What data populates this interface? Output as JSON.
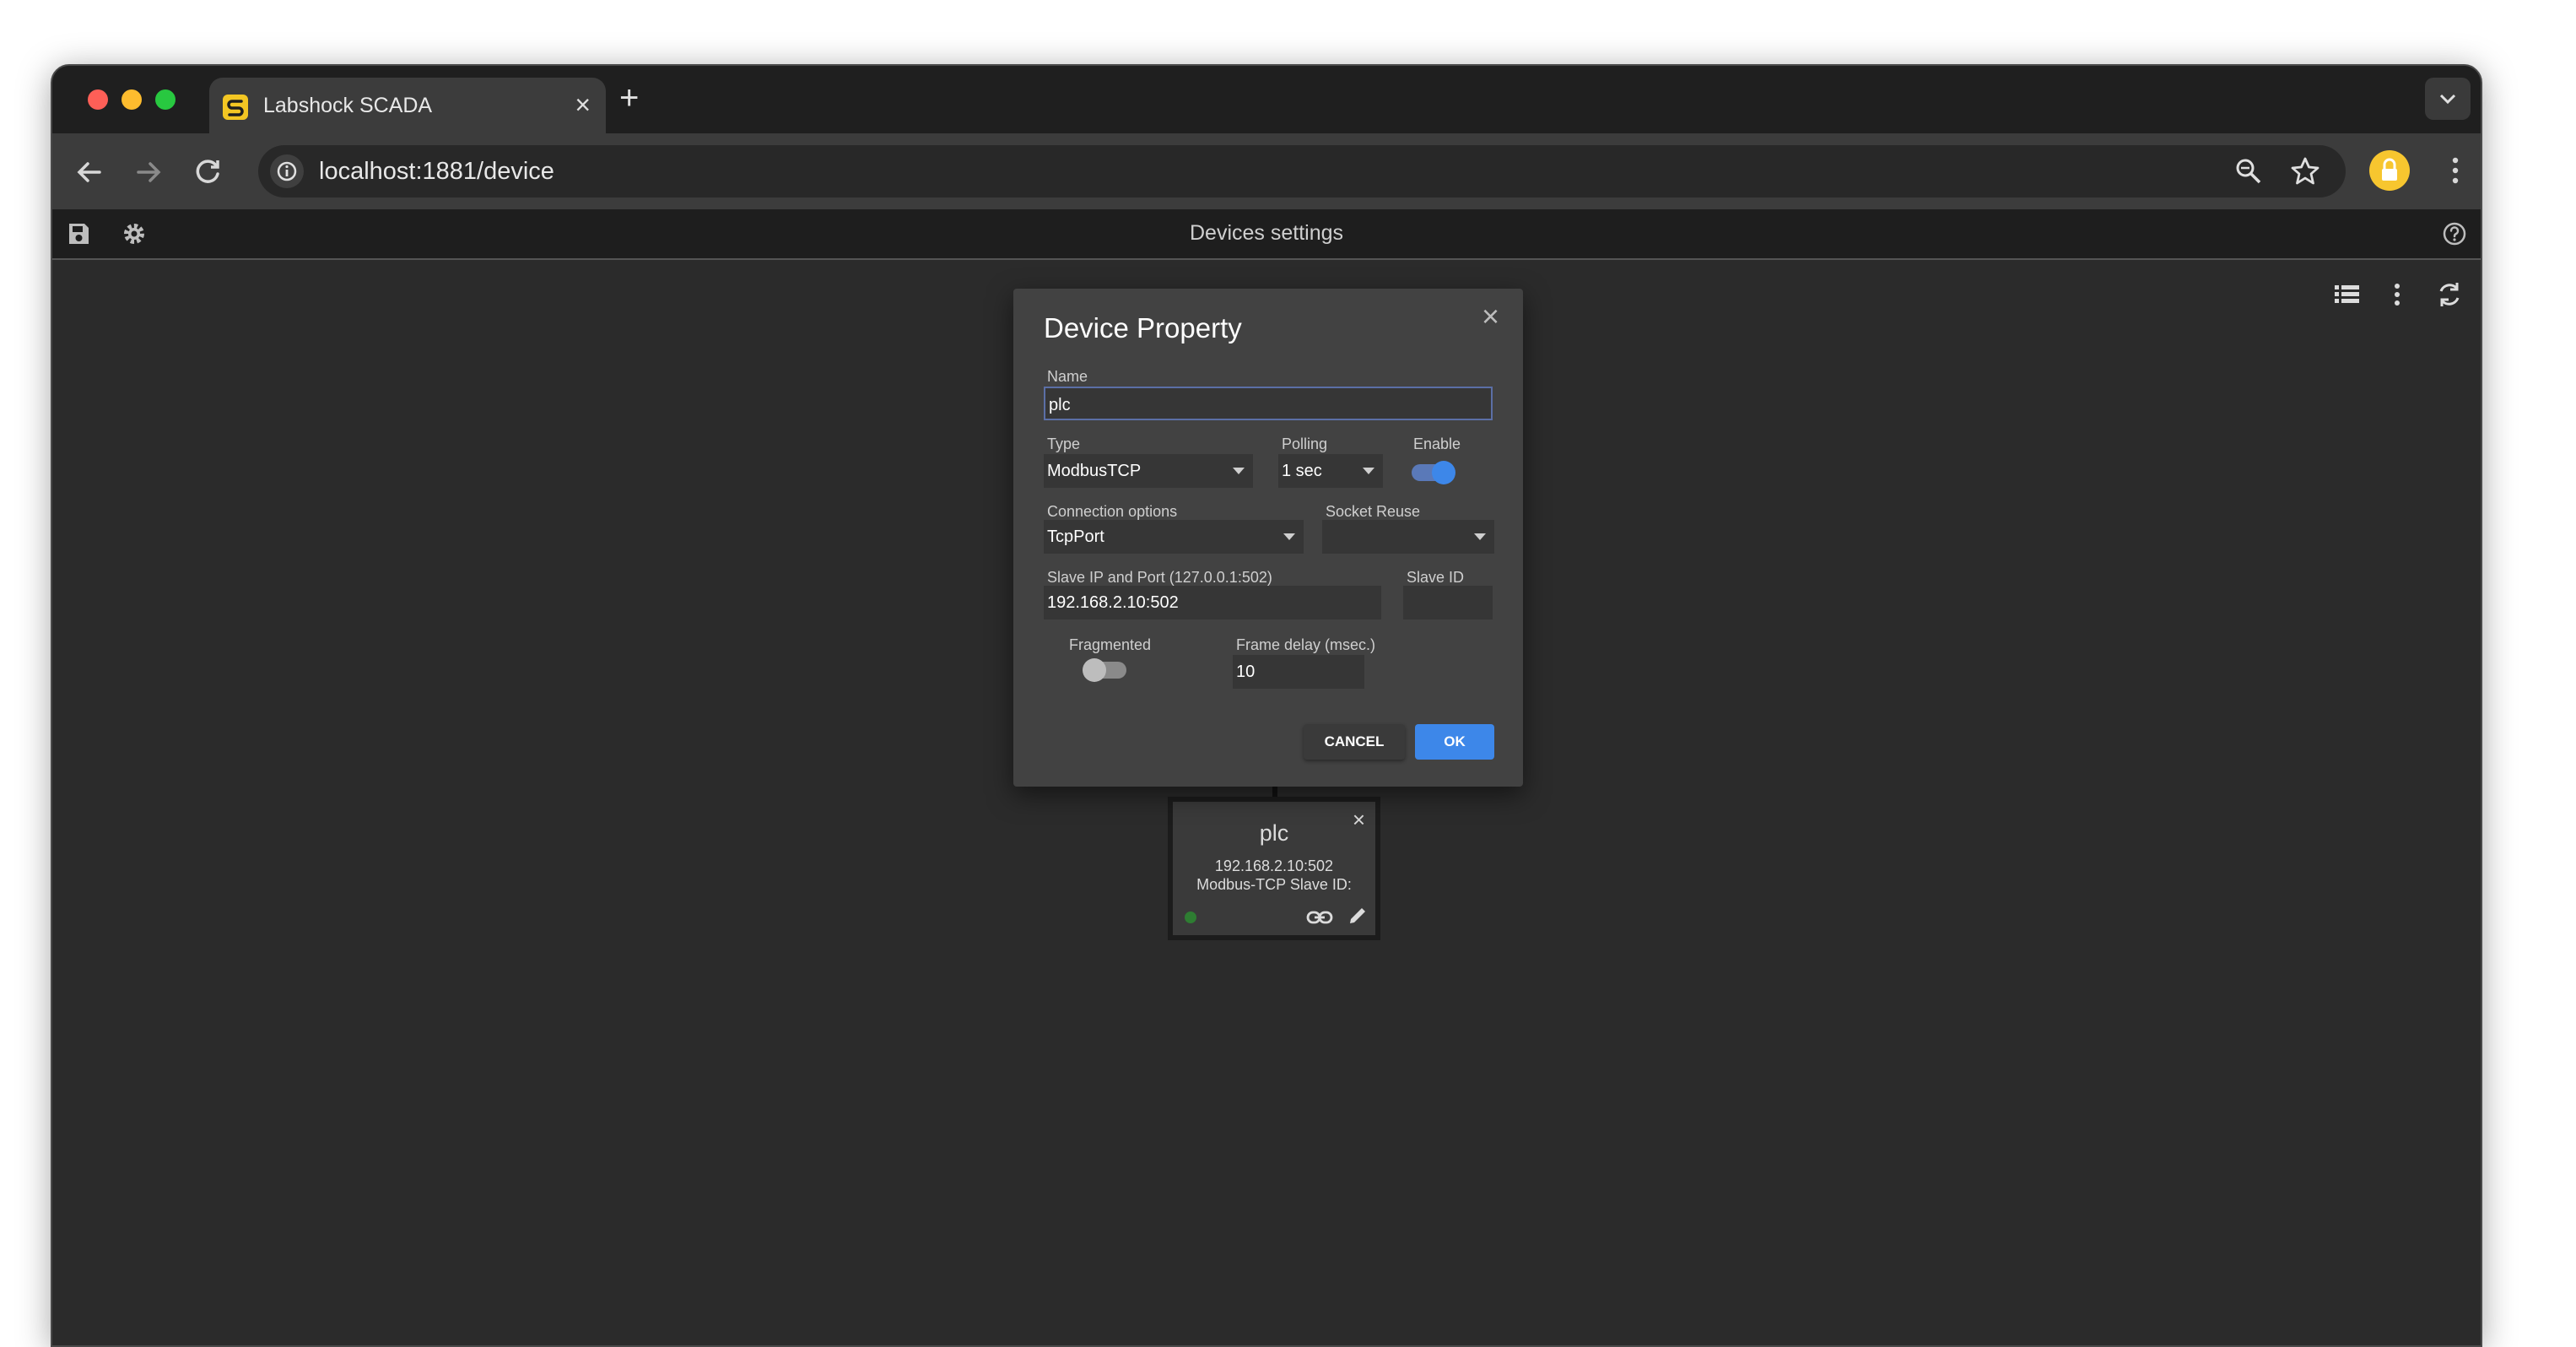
{
  "browser": {
    "tab_title": "Labshock SCADA",
    "url": "localhost:1881/device",
    "colors": {
      "tab_active": "#3c3c3c",
      "titlebar": "#1f1f1f",
      "profile": "#f7c62f"
    }
  },
  "app": {
    "header_title": "Devices settings"
  },
  "device_card": {
    "name": "plc",
    "address": "192.168.2.10:502",
    "info": "Modbus-TCP Slave ID:",
    "status_color": "#2e7d32"
  },
  "dialog": {
    "title": "Device Property",
    "name_label": "Name",
    "name_value": "plc",
    "type_label": "Type",
    "type_value": "ModbusTCP",
    "polling_label": "Polling",
    "polling_value": "1 sec",
    "enable_label": "Enable",
    "enable_on": true,
    "connection_label": "Connection options",
    "connection_value": "TcpPort",
    "socket_reuse_label": "Socket Reuse",
    "socket_reuse_value": "",
    "slave_ip_label": "Slave IP and Port (127.0.0.1:502)",
    "slave_ip_value": "192.168.2.10:502",
    "slave_id_label": "Slave ID",
    "slave_id_value": "",
    "fragmented_label": "Fragmented",
    "fragmented_on": false,
    "frame_delay_label": "Frame delay (msec.)",
    "frame_delay_value": "10",
    "cancel_label": "CANCEL",
    "ok_label": "OK",
    "accent_color": "#3d87e9"
  }
}
